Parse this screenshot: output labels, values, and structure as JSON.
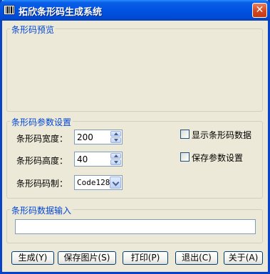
{
  "window": {
    "title": "拓欣条形码生成系统",
    "close_glyph": "✕"
  },
  "preview": {
    "legend": "条形码预览"
  },
  "settings": {
    "legend": "条形码参数设置",
    "width_label": "条形码宽度：",
    "width_value": "200",
    "height_label": "条形码高度：",
    "height_value": "40",
    "symbology_label": "条形码码制：",
    "symbology_value": "Code128",
    "show_data_label": "显示条形码数据",
    "show_data_checked": false,
    "save_params_label": "保存参数设置",
    "save_params_checked": false
  },
  "input": {
    "legend": "条形码数据输入",
    "value": ""
  },
  "buttons": {
    "generate": "生成(Y)",
    "save_image": "保存图片(S)",
    "print": "打印(P)",
    "exit": "退出(C)",
    "about": "关于(A)"
  }
}
